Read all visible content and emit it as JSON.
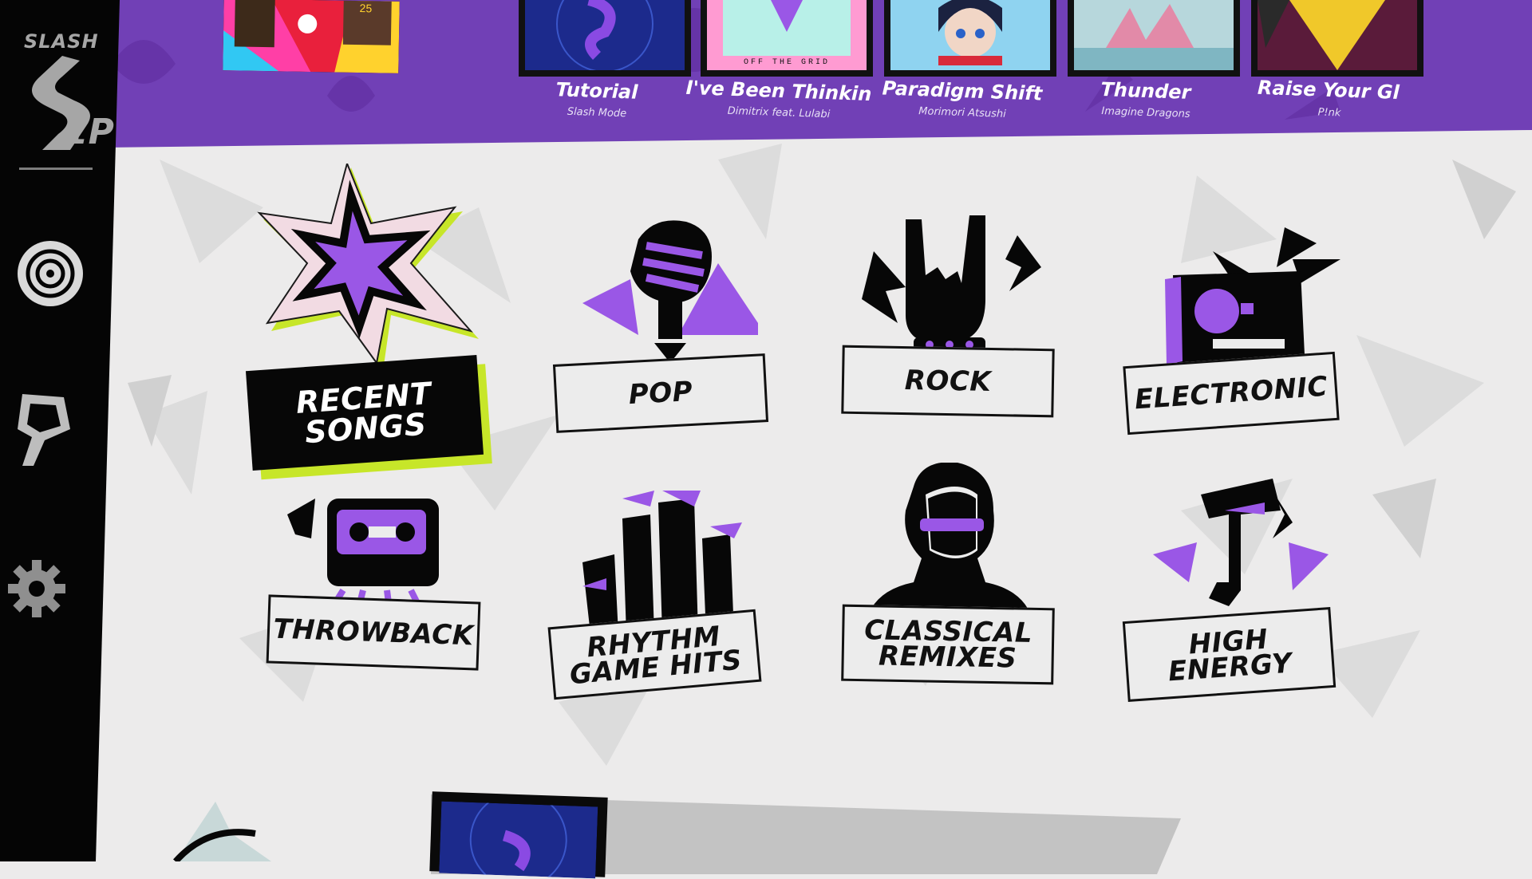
{
  "sidebar": {
    "mode_label": "SLASH",
    "player_label": "1P",
    "icons": [
      "slash-logo-icon",
      "disc-icon",
      "search-icon",
      "gear-icon"
    ]
  },
  "songs": [
    {
      "title": "",
      "artist": "",
      "art_number": "25"
    },
    {
      "title": "Tutorial",
      "artist": "Slash Mode"
    },
    {
      "title": "I've Been Thinkin",
      "artist": "Dimitrix feat. Lulabi",
      "art_text": "OFF THE GRID"
    },
    {
      "title": "Paradigm Shift",
      "artist": "Morimori Atsushi"
    },
    {
      "title": "Thunder",
      "artist": "Imagine Dragons"
    },
    {
      "title": "Raise Your Gl",
      "artist": "P!nk"
    }
  ],
  "genres": [
    {
      "label": "RECENT SONGS",
      "icon": "star-icon"
    },
    {
      "label": "POP",
      "icon": "microphone-icon"
    },
    {
      "label": "ROCK",
      "icon": "rock-hand-icon"
    },
    {
      "label": "ELECTRONIC",
      "icon": "boombox-icon"
    },
    {
      "label": "THROWBACK",
      "icon": "cassette-icon"
    },
    {
      "label": "RHYTHM GAME HITS",
      "icon": "city-skyline-icon"
    },
    {
      "label": "CLASSICAL REMIXES",
      "icon": "composer-bust-icon"
    },
    {
      "label": "HIGH ENERGY",
      "icon": "music-note-icon"
    }
  ],
  "colors": {
    "purple": "#7140b6",
    "accent_purple": "#9a57e6",
    "lime": "#c7e629",
    "black": "#070707",
    "background": "#ecebeb"
  }
}
